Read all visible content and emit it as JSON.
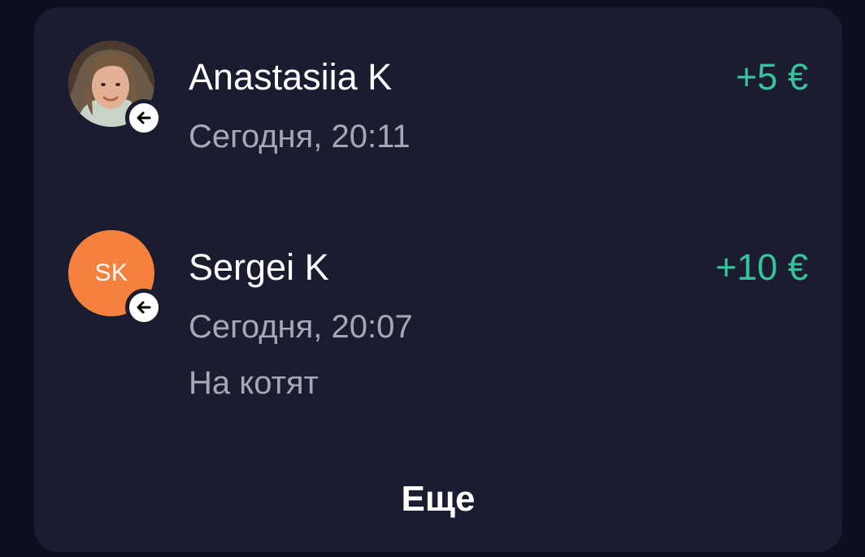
{
  "transactions": [
    {
      "name": "Anastasiia K",
      "date": "Сегодня, 20:11",
      "amount": "+5 €",
      "avatar": {
        "type": "photo"
      },
      "direction_icon": "arrow-left-icon"
    },
    {
      "name": "Sergei K",
      "date": "Сегодня, 20:07",
      "comment": "На котят",
      "amount": "+10 €",
      "avatar": {
        "type": "initials",
        "initials": "SK",
        "color": "#f6813e"
      },
      "direction_icon": "arrow-left-icon"
    }
  ],
  "more_label": "Еще",
  "colors": {
    "background": "#0d0e1f",
    "card": "#1b1c30",
    "amount_positive": "#35c49b",
    "secondary_text": "#a7a8b6"
  }
}
